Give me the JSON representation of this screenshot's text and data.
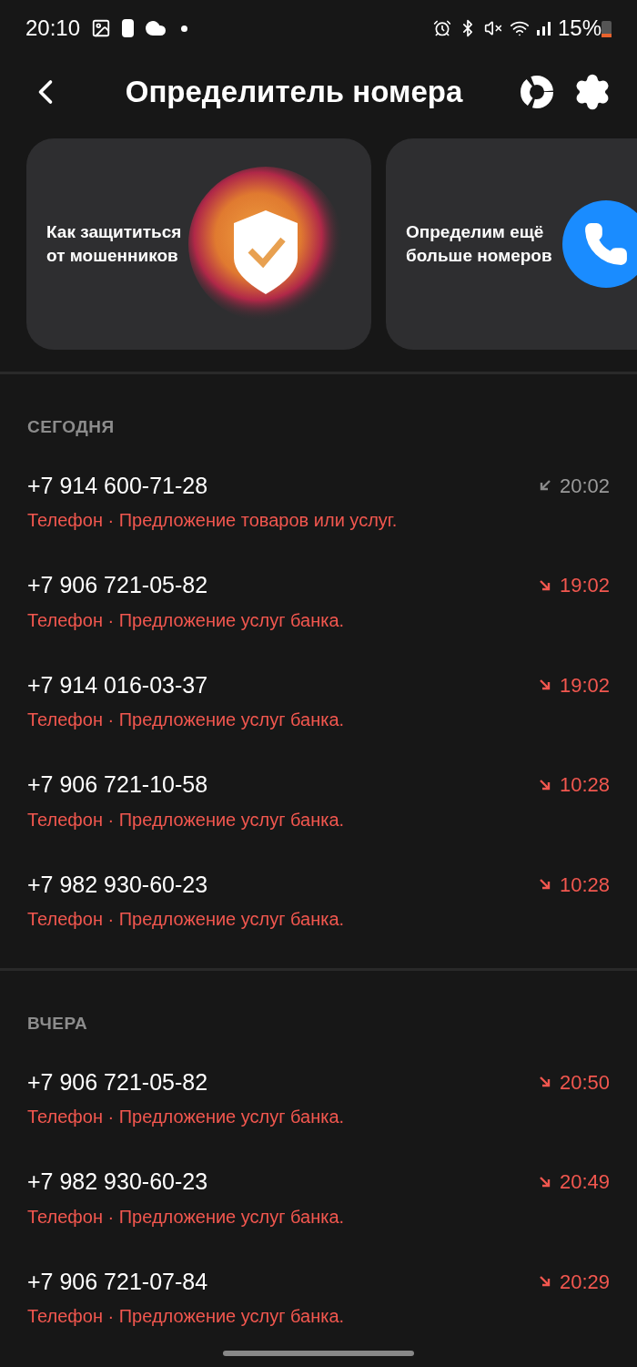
{
  "status_bar": {
    "time": "20:10",
    "battery": "15%"
  },
  "header": {
    "title": "Определитель номера"
  },
  "cards": [
    {
      "kind": "shield",
      "text": "Как защититься от мошенников"
    },
    {
      "kind": "phone",
      "text": "Определим ещё больше номеров"
    }
  ],
  "sections": [
    {
      "title": "СЕГОДНЯ",
      "calls": [
        {
          "number": "+7 914 600-71-28",
          "caption": "Телефон · Предложение товаров или услуг.",
          "time": "20:02",
          "kind": "incoming"
        },
        {
          "number": "+7 906 721-05-82",
          "caption": "Телефон · Предложение услуг банка.",
          "time": "19:02",
          "kind": "missed"
        },
        {
          "number": "+7 914 016-03-37",
          "caption": "Телефон · Предложение услуг банка.",
          "time": "19:02",
          "kind": "missed"
        },
        {
          "number": "+7 906 721-10-58",
          "caption": "Телефон · Предложение услуг банка.",
          "time": "10:28",
          "kind": "missed"
        },
        {
          "number": "+7 982 930-60-23",
          "caption": "Телефон · Предложение услуг банка.",
          "time": "10:28",
          "kind": "missed"
        }
      ]
    },
    {
      "title": "ВЧЕРА",
      "calls": [
        {
          "number": "+7 906 721-05-82",
          "caption": "Телефон · Предложение услуг банка.",
          "time": "20:50",
          "kind": "missed"
        },
        {
          "number": "+7 982 930-60-23",
          "caption": "Телефон · Предложение услуг банка.",
          "time": "20:49",
          "kind": "missed"
        },
        {
          "number": "+7 906 721-07-84",
          "caption": "Телефон · Предложение услуг банка.",
          "time": "20:29",
          "kind": "missed"
        }
      ]
    }
  ]
}
